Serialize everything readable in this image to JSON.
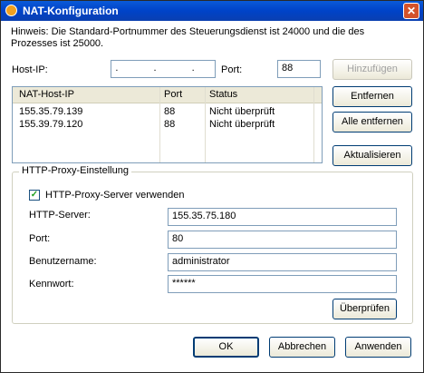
{
  "window": {
    "title": "NAT-Konfiguration",
    "close_label": "✕"
  },
  "hint": "Hinweis: Die Standard-Portnummer des Steuerungsdienst ist 24000 und die des Prozesses ist 25000.",
  "host": {
    "ip_label": "Host-IP:",
    "ip_value": ". . .",
    "port_label": "Port:",
    "port_value": "88"
  },
  "list": {
    "columns": [
      "NAT-Host-IP",
      "Port",
      "Status"
    ],
    "rows": [
      {
        "ip": "155.35.79.139",
        "port": "88",
        "status": "Nicht überprüft"
      },
      {
        "ip": "155.39.79.120",
        "port": "88",
        "status": "Nicht überprüft"
      }
    ]
  },
  "buttons": {
    "add": "Hinzufügen",
    "remove": "Entfernen",
    "remove_all": "Alle entfernen",
    "refresh": "Aktualisieren",
    "verify": "Überprüfen",
    "ok": "OK",
    "cancel": "Abbrechen",
    "apply": "Anwenden"
  },
  "proxy": {
    "group_title": "HTTP-Proxy-Einstellung",
    "use_label": "HTTP-Proxy-Server verwenden",
    "use_checked": true,
    "server_label": "HTTP-Server:",
    "server_value": "155.35.75.180",
    "port_label": "Port:",
    "port_value": "80",
    "user_label": "Benutzername:",
    "user_value": "administrator",
    "password_label": "Kennwort:",
    "password_value": "******"
  }
}
